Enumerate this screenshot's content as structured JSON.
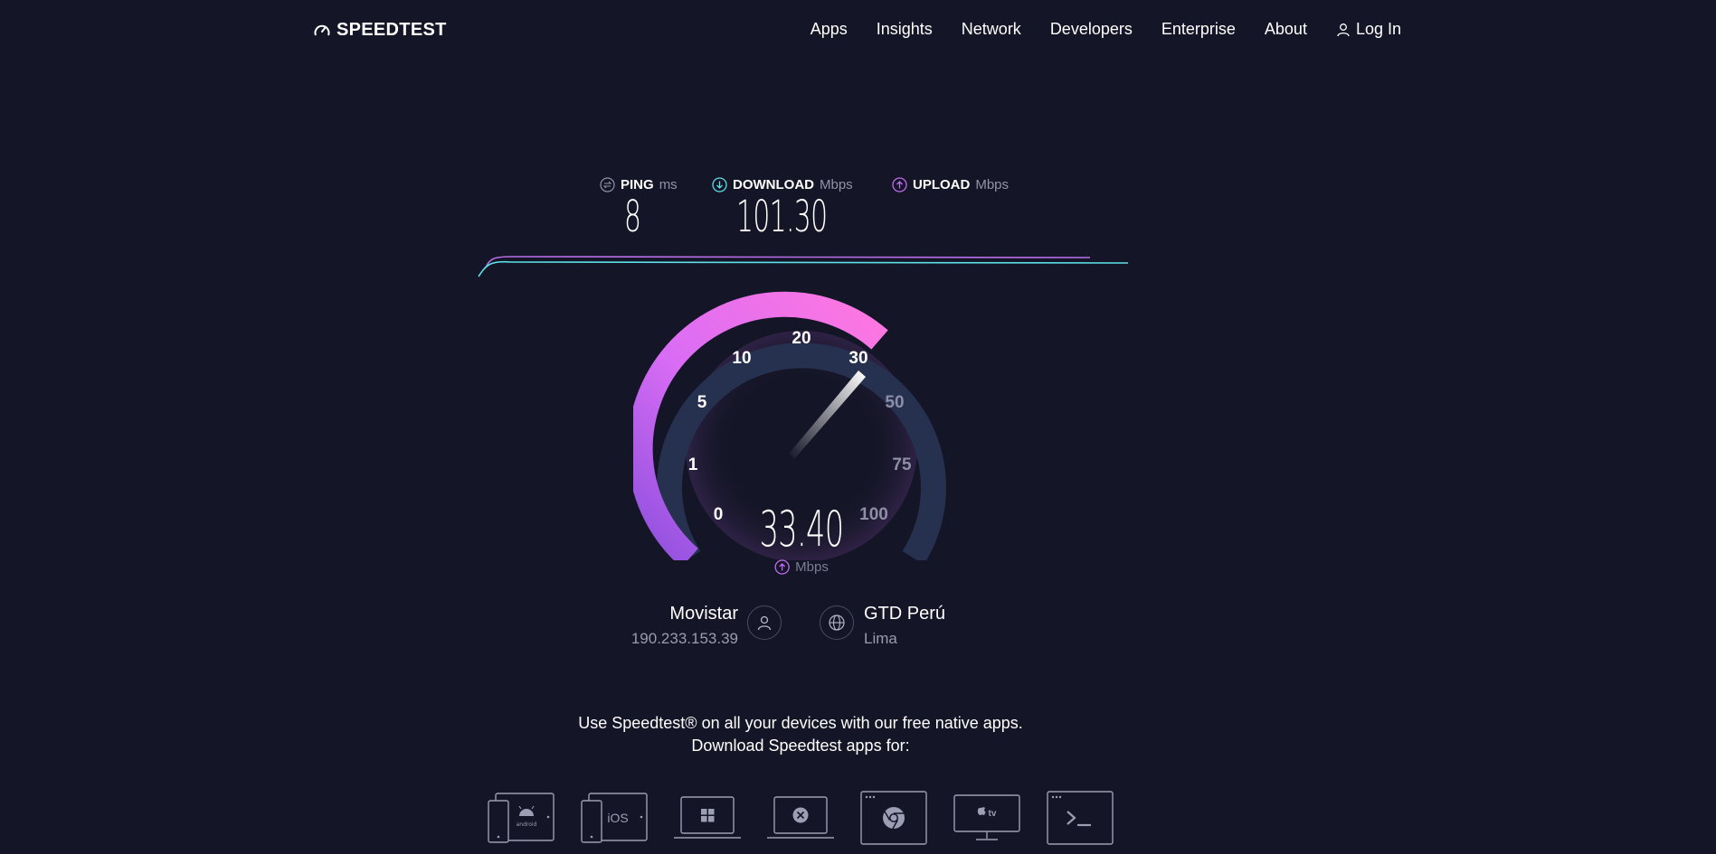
{
  "brand": {
    "name": "SPEEDTEST"
  },
  "nav": {
    "items": [
      "Apps",
      "Insights",
      "Network",
      "Developers",
      "Enterprise",
      "About"
    ],
    "login": "Log In"
  },
  "metrics": {
    "ping": {
      "label": "PING",
      "unit": "ms",
      "value": "8"
    },
    "download": {
      "label": "DOWNLOAD",
      "unit": "Mbps",
      "value": "101.30"
    },
    "upload": {
      "label": "UPLOAD",
      "unit": "Mbps",
      "value": ""
    }
  },
  "gauge": {
    "scale_labels": [
      "0",
      "1",
      "5",
      "10",
      "20",
      "30",
      "50",
      "75",
      "100"
    ],
    "current_value": "33.40",
    "unit": "Mbps",
    "colors": {
      "active_start": "#8b4fdd",
      "active_end": "#ff77e0",
      "inactive": "#26314f"
    }
  },
  "provider": {
    "name": "Movistar",
    "ip": "190.233.153.39"
  },
  "server": {
    "name": "GTD Perú",
    "location": "Lima"
  },
  "promo": {
    "line1": "Use Speedtest® on all your devices with our free native apps.",
    "line2": "Download Speedtest apps for:"
  },
  "apps": {
    "android_label": "android",
    "ios_label": "iOS",
    "tv_label": "tv"
  },
  "colors": {
    "background": "#141526",
    "download_accent": "#5ce0e6",
    "upload_accent": "#c06cf0"
  }
}
